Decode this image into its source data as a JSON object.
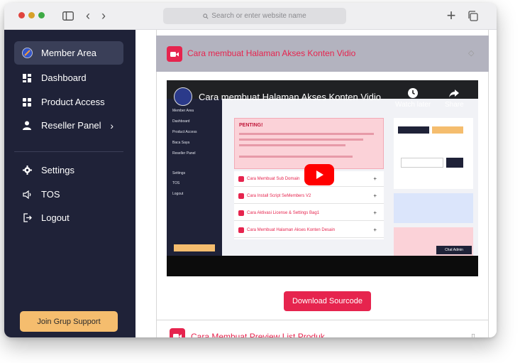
{
  "browser": {
    "address_placeholder": "Search or enter website name"
  },
  "sidebar": {
    "items": [
      {
        "label": "Member Area",
        "icon": "member-logo-icon"
      },
      {
        "label": "Dashboard",
        "icon": "dashboard-icon"
      },
      {
        "label": "Product Access",
        "icon": "grid-icon"
      },
      {
        "label": "Reseller Panel",
        "icon": "user-icon",
        "chevron": "›"
      },
      {
        "label": "Settings",
        "icon": "gear-icon"
      },
      {
        "label": "TOS",
        "icon": "speaker-icon"
      },
      {
        "label": "Logout",
        "icon": "logout-icon"
      }
    ],
    "join_button": "Join Grup Support"
  },
  "content": {
    "section1_title": "Cara membuat Halaman Akses Konten Vidio",
    "video": {
      "title": "Cara membuat Halaman Akses Konten Vidio",
      "watch_later": "Watch later",
      "share": "Share",
      "inner_warning_title": "PENTING!",
      "inner_rows": [
        "Cara Membuat Sub Domain",
        "Cara Install Script SeMembers V2",
        "Cara Aktivasi License & Settings Bag1",
        "Cara Membuat Halaman Akses Konten Desain"
      ],
      "inner_sidebar": [
        "Member Area",
        "Dashboard",
        "Product Access",
        "Baca Saya",
        "Reseller Panel",
        "Settings",
        "TOS",
        "Logout"
      ],
      "chat_admin": "Chat Admin"
    },
    "download_button": "Download Sourcode",
    "section2_title": "Cara Membuat Preview List Produk"
  },
  "colors": {
    "sidebar_bg": "#1f2238",
    "accent": "#e6244e",
    "join_button": "#f5bd6e"
  }
}
